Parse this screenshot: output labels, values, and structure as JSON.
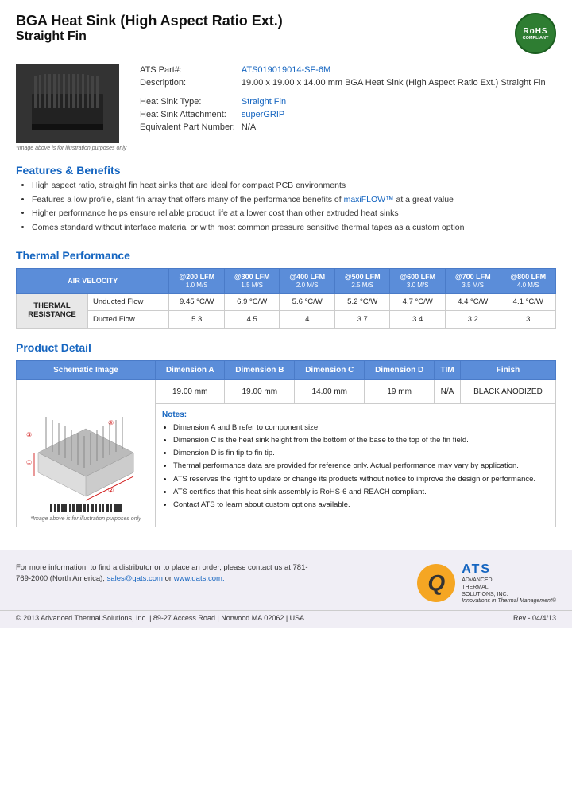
{
  "header": {
    "title_line1": "BGA Heat Sink (High Aspect Ratio Ext.)",
    "title_line2": "Straight Fin",
    "rohs": {
      "text": "RoHS",
      "sub": "COMPLIANT"
    }
  },
  "specs": {
    "part_label": "ATS Part#:",
    "part_value": "ATS019019014-SF-6M",
    "desc_label": "Description:",
    "desc_value": "19.00 x 19.00 x 14.00 mm  BGA Heat Sink (High Aspect Ratio Ext.) Straight Fin",
    "type_label": "Heat Sink Type:",
    "type_value": "Straight Fin",
    "attach_label": "Heat Sink Attachment:",
    "attach_value": "superGRIP",
    "equiv_label": "Equivalent Part Number:",
    "equiv_value": "N/A"
  },
  "image_caption": "*Image above is for illustration purposes only",
  "features": {
    "title": "Features & Benefits",
    "items": [
      "High aspect ratio, straight fin heat sinks that are ideal for compact PCB environments",
      "Features a low profile, slant fin array that offers many of the performance benefits of maxiFLOW™ at a great value",
      "Higher performance helps ensure reliable product life at a lower cost than other extruded heat sinks",
      "Comes standard without interface material or with most common pressure sensitive thermal tapes as a custom option"
    ]
  },
  "thermal": {
    "title": "Thermal Performance",
    "table": {
      "air_velocity": "AIR VELOCITY",
      "columns": [
        {
          "lfm": "@200 LFM",
          "ms": "1.0 M/S"
        },
        {
          "lfm": "@300 LFM",
          "ms": "1.5 M/S"
        },
        {
          "lfm": "@400 LFM",
          "ms": "2.0 M/S"
        },
        {
          "lfm": "@500 LFM",
          "ms": "2.5 M/S"
        },
        {
          "lfm": "@600 LFM",
          "ms": "3.0 M/S"
        },
        {
          "lfm": "@700 LFM",
          "ms": "3.5 M/S"
        },
        {
          "lfm": "@800 LFM",
          "ms": "4.0 M/S"
        }
      ],
      "row_label": "THERMAL RESISTANCE",
      "unducted_label": "Unducted Flow",
      "unducted_values": [
        "9.45 °C/W",
        "6.9 °C/W",
        "5.6 °C/W",
        "5.2 °C/W",
        "4.7 °C/W",
        "4.4 °C/W",
        "4.1 °C/W"
      ],
      "ducted_label": "Ducted Flow",
      "ducted_values": [
        "5.3",
        "4.5",
        "4",
        "3.7",
        "3.4",
        "3.2",
        "3"
      ]
    }
  },
  "product_detail": {
    "title": "Product Detail",
    "col_headers": [
      "Schematic Image",
      "Dimension A",
      "Dimension B",
      "Dimension C",
      "Dimension D",
      "TIM",
      "Finish"
    ],
    "dim_values": [
      "19.00 mm",
      "19.00 mm",
      "14.00 mm",
      "19 mm",
      "N/A",
      "BLACK ANODIZED"
    ],
    "notes_title": "Notes:",
    "notes": [
      "Dimension A and B refer to component size.",
      "Dimension C is the heat sink height from the bottom of the base to the top of the fin field.",
      "Dimension D is fin tip to fin tip.",
      "Thermal performance data are provided for reference only. Actual performance may vary by application.",
      "ATS reserves the right to update or change its products without notice to improve the design or performance.",
      "ATS certifies that this heat sink assembly is RoHS-6 and REACH compliant.",
      "Contact ATS to learn about custom options available."
    ]
  },
  "footer": {
    "text": "For more information, to find a distributor or to place an order, please contact us at 781-769-2000 (North America),",
    "email": "sales@qats.com",
    "or_text": "or",
    "website": "www.qats.com.",
    "copyright": "© 2013 Advanced Thermal Solutions, Inc.  |  89-27 Access Road  |  Norwood MA   02062  |  USA",
    "page_num": "Rev - 04/4/13",
    "ats_label": "ATS",
    "ats_full": "ADVANCED\nTHERMAL\nSOLUTIONS, INC.",
    "tagline": "Innovations in Thermal Management®"
  }
}
